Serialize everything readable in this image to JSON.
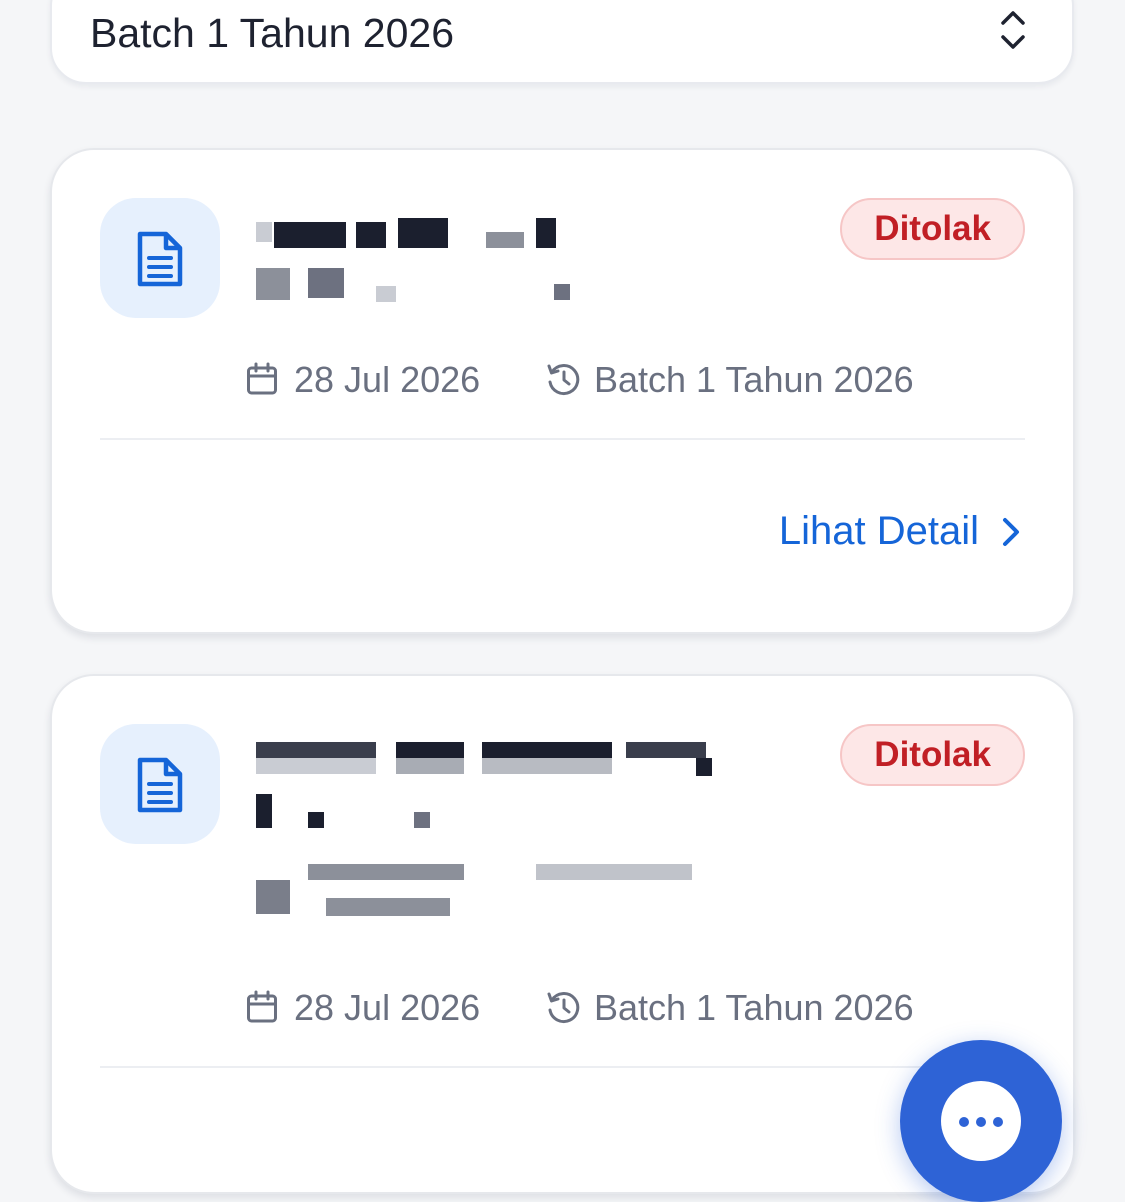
{
  "batch_selector": {
    "value": "Batch 1 Tahun 2026",
    "icon": "chevron-up-down-icon"
  },
  "submissions": [
    {
      "icon": "document-icon",
      "status": "Ditolak",
      "date": "28 Jul 2026",
      "batch": "Batch 1 Tahun 2026",
      "action_label": "Lihat Detail"
    },
    {
      "icon": "document-icon",
      "status": "Ditolak",
      "date": "28 Jul 2026",
      "batch": "Batch 1 Tahun 2026"
    }
  ],
  "colors": {
    "accent": "#1565d8",
    "status_rejected_text": "#c11f25",
    "status_rejected_bg": "#fde7e7",
    "fab": "#2e63d6"
  },
  "fab": {
    "icon": "more-horizontal-icon"
  }
}
